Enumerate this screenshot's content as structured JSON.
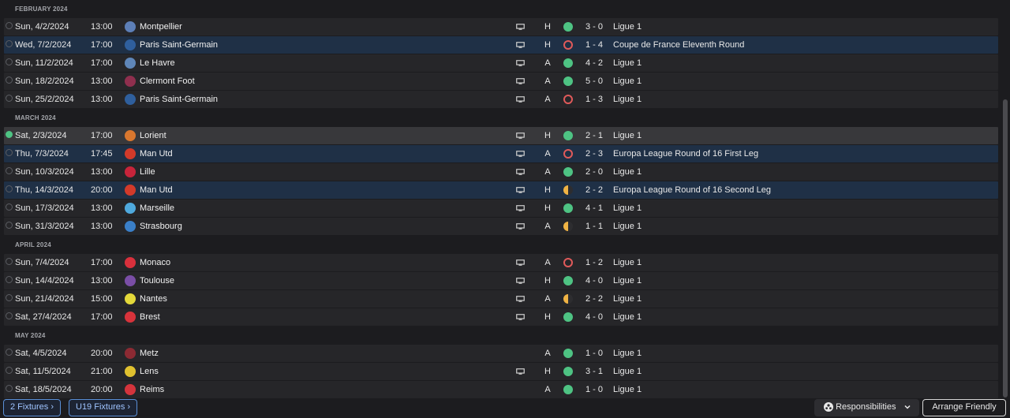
{
  "fixtures": [
    {
      "month": "FEBRUARY 2024",
      "matches": [
        {
          "date": "Sun, 4/2/2024",
          "time": "13:00",
          "team": "Montpellier",
          "badge": "#5d7fb7",
          "tv": true,
          "venue": "H",
          "result": "W",
          "score": "3 - 0",
          "competition": "Ligue 1",
          "euro": false,
          "selected": false,
          "checked": false
        },
        {
          "date": "Wed, 7/2/2024",
          "time": "17:00",
          "team": "Paris Saint-Germain",
          "badge": "#2f5f9d",
          "tv": true,
          "venue": "H",
          "result": "L",
          "score": "1 - 4",
          "competition": "Coupe de France Eleventh Round",
          "euro": true,
          "selected": false,
          "checked": false
        },
        {
          "date": "Sun, 11/2/2024",
          "time": "17:00",
          "team": "Le Havre",
          "badge": "#5f86b8",
          "tv": true,
          "venue": "A",
          "result": "W",
          "score": "4 - 2",
          "competition": "Ligue 1",
          "euro": false,
          "selected": false,
          "checked": false
        },
        {
          "date": "Sun, 18/2/2024",
          "time": "13:00",
          "team": "Clermont Foot",
          "badge": "#8f2f4e",
          "tv": true,
          "venue": "A",
          "result": "W",
          "score": "5 - 0",
          "competition": "Ligue 1",
          "euro": false,
          "selected": false,
          "checked": false
        },
        {
          "date": "Sun, 25/2/2024",
          "time": "13:00",
          "team": "Paris Saint-Germain",
          "badge": "#2f5f9d",
          "tv": true,
          "venue": "A",
          "result": "L",
          "score": "1 - 3",
          "competition": "Ligue 1",
          "euro": false,
          "selected": false,
          "checked": false
        }
      ]
    },
    {
      "month": "MARCH 2024",
      "matches": [
        {
          "date": "Sat, 2/3/2024",
          "time": "17:00",
          "team": "Lorient",
          "badge": "#d9772e",
          "tv": true,
          "venue": "H",
          "result": "W",
          "score": "2 - 1",
          "competition": "Ligue 1",
          "euro": false,
          "selected": true,
          "checked": true
        },
        {
          "date": "Thu, 7/3/2024",
          "time": "17:45",
          "team": "Man Utd",
          "badge": "#d23a2a",
          "tv": true,
          "venue": "A",
          "result": "L",
          "score": "2 - 3",
          "competition": "Europa League Round of 16  First Leg",
          "euro": true,
          "selected": false,
          "checked": false
        },
        {
          "date": "Sun, 10/3/2024",
          "time": "13:00",
          "team": "Lille",
          "badge": "#c8243a",
          "tv": true,
          "venue": "A",
          "result": "W",
          "score": "2 - 0",
          "competition": "Ligue 1",
          "euro": false,
          "selected": false,
          "checked": false
        },
        {
          "date": "Thu, 14/3/2024",
          "time": "20:00",
          "team": "Man Utd",
          "badge": "#d23a2a",
          "tv": true,
          "venue": "H",
          "result": "D",
          "score": "2 - 2",
          "competition": "Europa League Round of 16  Second Leg",
          "euro": true,
          "selected": false,
          "checked": false
        },
        {
          "date": "Sun, 17/3/2024",
          "time": "13:00",
          "team": "Marseille",
          "badge": "#4fa9dd",
          "tv": true,
          "venue": "H",
          "result": "W",
          "score": "4 - 1",
          "competition": "Ligue 1",
          "euro": false,
          "selected": false,
          "checked": false
        },
        {
          "date": "Sun, 31/3/2024",
          "time": "13:00",
          "team": "Strasbourg",
          "badge": "#3a7fc8",
          "tv": true,
          "venue": "A",
          "result": "D",
          "score": "1 - 1",
          "competition": "Ligue 1",
          "euro": false,
          "selected": false,
          "checked": false
        }
      ]
    },
    {
      "month": "APRIL 2024",
      "matches": [
        {
          "date": "Sun, 7/4/2024",
          "time": "17:00",
          "team": "Monaco",
          "badge": "#d9303c",
          "tv": true,
          "venue": "A",
          "result": "L",
          "score": "1 - 2",
          "competition": "Ligue 1",
          "euro": false,
          "selected": false,
          "checked": false
        },
        {
          "date": "Sun, 14/4/2024",
          "time": "13:00",
          "team": "Toulouse",
          "badge": "#7a4ea6",
          "tv": true,
          "venue": "H",
          "result": "W",
          "score": "4 - 0",
          "competition": "Ligue 1",
          "euro": false,
          "selected": false,
          "checked": false
        },
        {
          "date": "Sun, 21/4/2024",
          "time": "15:00",
          "team": "Nantes",
          "badge": "#e3d83a",
          "tv": true,
          "venue": "A",
          "result": "D",
          "score": "2 - 2",
          "competition": "Ligue 1",
          "euro": false,
          "selected": false,
          "checked": false
        },
        {
          "date": "Sat, 27/4/2024",
          "time": "17:00",
          "team": "Brest",
          "badge": "#d8333b",
          "tv": true,
          "venue": "H",
          "result": "W",
          "score": "4 - 0",
          "competition": "Ligue 1",
          "euro": false,
          "selected": false,
          "checked": false
        }
      ]
    },
    {
      "month": "MAY 2024",
      "matches": [
        {
          "date": "Sat, 4/5/2024",
          "time": "20:00",
          "team": "Metz",
          "badge": "#8c2a33",
          "tv": false,
          "venue": "A",
          "result": "W",
          "score": "1 - 0",
          "competition": "Ligue 1",
          "euro": false,
          "selected": false,
          "checked": false
        },
        {
          "date": "Sat, 11/5/2024",
          "time": "21:00",
          "team": "Lens",
          "badge": "#e0c12f",
          "tv": true,
          "venue": "H",
          "result": "W",
          "score": "3 - 1",
          "competition": "Ligue 1",
          "euro": false,
          "selected": false,
          "checked": false
        },
        {
          "date": "Sat, 18/5/2024",
          "time": "20:00",
          "team": "Reims",
          "badge": "#d4343c",
          "tv": false,
          "venue": "A",
          "result": "W",
          "score": "1 - 0",
          "competition": "Ligue 1",
          "euro": false,
          "selected": false,
          "checked": false
        }
      ]
    }
  ],
  "bottom": {
    "fixtures_link": "2 Fixtures",
    "u19_link": "U19 Fixtures",
    "responsibilities": "Responsibilities",
    "arrange_friendly": "Arrange Friendly"
  },
  "colors": {
    "win": "#4ec383",
    "loss": "#e05a5a",
    "draw": "#f0b344",
    "accent": "#5a8fd6"
  }
}
